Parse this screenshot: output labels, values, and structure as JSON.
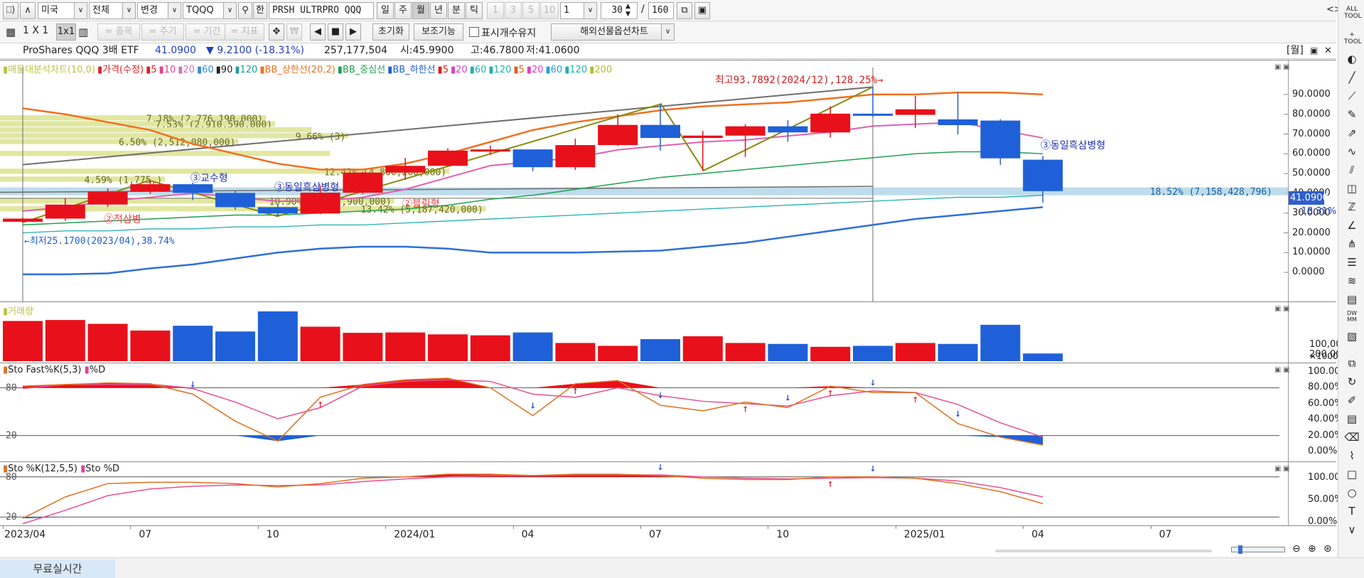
{
  "toolbar1": {
    "market": "미국",
    "scope": "전체",
    "change": "변경",
    "code": "TQQQ",
    "han": "한",
    "name": "PRSH ULTRPRO QQQ",
    "periods": [
      {
        "label": "일"
      },
      {
        "label": "주"
      },
      {
        "label": "월"
      },
      {
        "label": "년"
      },
      {
        "label": "분"
      },
      {
        "label": "틱"
      }
    ],
    "intervals": [
      {
        "label": "1"
      },
      {
        "label": "3"
      },
      {
        "label": "5"
      },
      {
        "label": "10"
      }
    ],
    "interval_value": "1",
    "count_value": "30",
    "total": "160",
    "slash": "/"
  },
  "toolbar2": {
    "layout_single": "1 X 1",
    "layout_1x1": "1x1",
    "item": "= 종목",
    "period": "= 주기",
    "range": "= 기간",
    "indicator": "= 지표",
    "reset": "초기화",
    "aux": "보조기능",
    "show_count": "표시개수유지",
    "futures": "해외선물옵션차트"
  },
  "info": {
    "name": "ProShares QQQ 3배 ETF",
    "price": "41.0900",
    "change": "▼ 9.2100 (-18.31%)",
    "volume": "257,177,504",
    "open": "시:45.9900",
    "high": "고:46.7800",
    "low": "저:41.0600",
    "period_tag": "[월]"
  },
  "price_panel": {
    "legend": [
      {
        "t": "매물대분석차트(10,0)",
        "c": "#b8c44a"
      },
      {
        "t": "가격(수정)",
        "c": "#e02020"
      },
      {
        "t": "5",
        "c": "#e02020"
      },
      {
        "t": "10",
        "c": "#e8408a"
      },
      {
        "t": "20",
        "c": "#d070c0"
      },
      {
        "t": "60",
        "c": "#3a8ad8"
      },
      {
        "t": "90",
        "c": "#222222"
      },
      {
        "t": "120",
        "c": "#20a0a0"
      },
      {
        "t": "BB_상한선(20,2)",
        "c": "#f07020"
      },
      {
        "t": "BB_중심선",
        "c": "#20a050"
      },
      {
        "t": "BB_하한선",
        "c": "#2060d0"
      },
      {
        "t": "5",
        "c": "#e02020"
      },
      {
        "t": "20",
        "c": "#e040c0"
      },
      {
        "t": "60",
        "c": "#20b0b0"
      },
      {
        "t": "120",
        "c": "#20b0b0"
      },
      {
        "t": "5",
        "c": "#e06020"
      },
      {
        "t": "20",
        "c": "#e040c0"
      },
      {
        "t": "60",
        "c": "#20a0e0"
      },
      {
        "t": "120",
        "c": "#20b0b0"
      },
      {
        "t": "200",
        "c": "#b0c030"
      }
    ],
    "y_ticks": [
      "90.0000",
      "80.0000",
      "70.0000",
      "60.0000",
      "50.0000",
      "40.0000",
      "30.0000",
      "20.0000",
      "10.0000",
      "0.0000"
    ],
    "current_price": "41.0900",
    "current_change": "-18.31%",
    "high_label": "최고93.7892(2024/12),128.25%→",
    "low_label": "←최저25.1700(2023/04),38.74%",
    "volume_profile_labels": [
      "7.18% (2,776,190,000)",
      "7.53% (2,910,590,000)",
      "6.50% (2,512,080,000)",
      "9.66% (3",
      "4.59% (1,775,",
      "12.42% (4,800,260,000)",
      "10.90% (4,212,900,000)",
      "13.42% (5,187,420,000)",
      "18.52% (7,158,428,796)"
    ],
    "vp_partial": "00,000)",
    "patterns": [
      {
        "text": "③교수형",
        "c": "#2030b0"
      },
      {
        "text": "③동일흑삼병형",
        "c": "#2030b0"
      },
      {
        "text": "②블릭형",
        "c": "#e04040"
      },
      {
        "text": "②적삼병",
        "c": "#e04040"
      },
      {
        "text": "③동일흑삼병형",
        "c": "#2030b0"
      }
    ]
  },
  "volume_panel": {
    "title": "거래량",
    "y_ticks": [
      "200,000",
      "100,000",
      "×10000"
    ]
  },
  "sto_fast": {
    "title_k": "Sto Fast%K(5,3)",
    "title_d": "%D",
    "y_ticks": [
      "100.00%",
      "80.00%",
      "60.00%",
      "40.00%",
      "20.00%",
      "0.00%"
    ],
    "levels": [
      "80",
      "20"
    ]
  },
  "sto_slow": {
    "title_k": "Sto %K(12,5,5)",
    "title_d": "Sto %D",
    "y_ticks": [
      "100.00%",
      "50.00%",
      "0.00%"
    ],
    "levels": [
      "80",
      "20"
    ]
  },
  "x_axis": [
    "2023/04",
    "07",
    "10",
    "2024/01",
    "04",
    "07",
    "10",
    "2025/01",
    "04",
    "07"
  ],
  "status": {
    "tab": "무료실시간"
  },
  "chart_data": {
    "type": "candlestick",
    "x": [
      "2023/04",
      "2023/05",
      "2023/06",
      "2023/07",
      "2023/08",
      "2023/09",
      "2023/10",
      "2023/11",
      "2023/12",
      "2024/01",
      "2024/02",
      "2024/03",
      "2024/04",
      "2024/05",
      "2024/06",
      "2024/07",
      "2024/08",
      "2024/09",
      "2024/10",
      "2024/11",
      "2024/12",
      "2025/01",
      "2025/02",
      "2025/03",
      "2025/04"
    ],
    "candles": [
      {
        "o": 25.6,
        "h": 27.9,
        "l": 25.2,
        "c": 27.2,
        "up": true
      },
      {
        "o": 27.2,
        "h": 37.6,
        "l": 26.1,
        "c": 34.3,
        "up": true
      },
      {
        "o": 34.3,
        "h": 42.5,
        "l": 33.1,
        "c": 40.8,
        "up": true
      },
      {
        "o": 40.8,
        "h": 46.5,
        "l": 39.7,
        "c": 44.6,
        "up": true
      },
      {
        "o": 44.6,
        "h": 45.4,
        "l": 36.6,
        "c": 40.2,
        "up": false
      },
      {
        "o": 40.2,
        "h": 41.2,
        "l": 31.6,
        "c": 33.0,
        "up": false
      },
      {
        "o": 33.0,
        "h": 34.2,
        "l": 28.4,
        "c": 29.8,
        "up": false
      },
      {
        "o": 29.8,
        "h": 43.8,
        "l": 29.4,
        "c": 40.3,
        "up": true
      },
      {
        "o": 40.3,
        "h": 51.0,
        "l": 39.6,
        "c": 50.5,
        "up": true
      },
      {
        "o": 50.5,
        "h": 58.0,
        "l": 46.9,
        "c": 53.9,
        "up": true
      },
      {
        "o": 53.9,
        "h": 62.8,
        "l": 53.5,
        "c": 61.6,
        "up": true
      },
      {
        "o": 61.6,
        "h": 64.2,
        "l": 59.6,
        "c": 62.2,
        "up": true
      },
      {
        "o": 62.2,
        "h": 61.5,
        "l": 51.2,
        "c": 53.2,
        "up": false
      },
      {
        "o": 53.2,
        "h": 67.7,
        "l": 51.8,
        "c": 64.4,
        "up": true
      },
      {
        "o": 64.4,
        "h": 80.0,
        "l": 64.0,
        "c": 74.6,
        "up": true
      },
      {
        "o": 74.6,
        "h": 85.2,
        "l": 61.6,
        "c": 68.0,
        "up": false
      },
      {
        "o": 68.0,
        "h": 71.6,
        "l": 51.5,
        "c": 69.2,
        "up": true
      },
      {
        "o": 69.2,
        "h": 75.0,
        "l": 58.4,
        "c": 73.9,
        "up": true
      },
      {
        "o": 73.9,
        "h": 77.0,
        "l": 66.2,
        "c": 70.8,
        "up": false
      },
      {
        "o": 70.8,
        "h": 84.0,
        "l": 68.3,
        "c": 80.3,
        "up": true
      },
      {
        "o": 80.3,
        "h": 93.8,
        "l": 78.6,
        "c": 79.7,
        "up": false
      },
      {
        "o": 79.7,
        "h": 89.3,
        "l": 73.0,
        "c": 82.5,
        "up": true
      },
      {
        "o": 77.4,
        "h": 91.2,
        "l": 69.8,
        "c": 74.5,
        "up": false
      },
      {
        "o": 76.8,
        "h": 77.5,
        "l": 54.4,
        "c": 57.7,
        "up": false
      },
      {
        "o": 57.0,
        "h": 58.9,
        "l": 35.3,
        "c": 41.1,
        "up": false
      }
    ],
    "volume_x10000": [
      210000,
      215000,
      195000,
      160000,
      185000,
      155000,
      260000,
      180000,
      148000,
      150000,
      140000,
      135000,
      150000,
      95000,
      80000,
      115000,
      130000,
      95000,
      90000,
      75000,
      80000,
      95000,
      90000,
      190000,
      40000
    ],
    "sto_fast_k": [
      82,
      84,
      86,
      85,
      72,
      38,
      13,
      68,
      84,
      90,
      92,
      80,
      45,
      85,
      89,
      58,
      51,
      62,
      55,
      82,
      74,
      74,
      35,
      18,
      8
    ],
    "sto_fast_d": [
      79,
      84,
      84,
      84,
      79,
      62,
      41,
      55,
      82,
      88,
      90,
      88,
      72,
      68,
      80,
      70,
      63,
      60,
      57,
      70,
      76,
      74,
      59,
      36,
      18
    ],
    "sto_slow_k": [
      18,
      50,
      70,
      72,
      72,
      70,
      65,
      70,
      78,
      80,
      84,
      84,
      82,
      84,
      84,
      82,
      78,
      76,
      76,
      80,
      80,
      78,
      70,
      58,
      40
    ],
    "sto_slow_d": [
      10,
      30,
      52,
      62,
      66,
      68,
      67,
      68,
      73,
      77,
      80,
      82,
      82,
      83,
      83,
      83,
      80,
      78,
      77,
      78,
      79,
      78,
      74,
      64,
      50
    ],
    "ma5": [
      31,
      33,
      36,
      38,
      40,
      38,
      36,
      36,
      38,
      42,
      48,
      54,
      56,
      58,
      62,
      64,
      66,
      67,
      69,
      71,
      74,
      75,
      76,
      72,
      68
    ],
    "ma20": [
      24,
      25,
      26,
      27,
      28,
      29,
      29,
      30,
      31,
      32,
      34,
      37,
      39,
      42,
      45,
      48,
      50,
      52,
      54,
      56,
      58,
      60,
      61,
      61,
      60
    ],
    "ma60": [
      20,
      21,
      21,
      22,
      22,
      23,
      23,
      24,
      24,
      25,
      26,
      27,
      28,
      29,
      30,
      31,
      32,
      33,
      34,
      35,
      36,
      37,
      38,
      38,
      39
    ],
    "bb_upper": [
      83,
      80,
      76,
      72,
      65,
      60,
      55,
      52,
      52,
      55,
      60,
      66,
      72,
      76,
      79,
      82,
      84,
      85,
      86,
      88,
      90,
      90,
      91,
      91,
      90
    ],
    "bb_lower": [
      -1,
      -1,
      -0.5,
      2,
      4,
      7,
      10,
      12,
      13,
      13,
      12,
      10,
      10,
      10,
      10.5,
      11,
      13,
      15,
      18,
      21,
      24,
      27,
      29,
      31,
      33
    ],
    "pnl": {
      "ylim": [
        -5,
        95
      ]
    },
    "volume_profile": [
      {
        "low": 76.5,
        "high": 79.5,
        "pct": "7.18%",
        "val": "2,776,190,000",
        "w": 0.29
      },
      {
        "low": 73.5,
        "high": 76.5,
        "pct": "7.53%",
        "val": "2,910,590,000",
        "w": 0.3
      },
      {
        "low": 70.5,
        "high": 73.5,
        "pct": "",
        "val": "",
        "w": 0.34
      },
      {
        "low": 67.5,
        "high": 70.5,
        "pct": "9.66%",
        "val": "3",
        "w": 0.38
      },
      {
        "low": 64.5,
        "high": 67.5,
        "pct": "6.50%",
        "val": "2,512,080,000",
        "w": 0.26
      },
      {
        "low": 58.5,
        "high": 61.5,
        "pct": "",
        "val": "00,000",
        "w": 0.36
      },
      {
        "low": 49.5,
        "high": 52.5,
        "pct": "12.42%",
        "val": "4,800,260,000",
        "w": 0.49
      },
      {
        "low": 45.5,
        "high": 48.5,
        "pct": "4.59%",
        "val": "1,775,",
        "w": 0.18
      },
      {
        "low": 34.5,
        "high": 37.5,
        "pct": "10.90%",
        "val": "4,212,900,000",
        "w": 0.43
      },
      {
        "low": 30.5,
        "high": 33.5,
        "pct": "13.42%",
        "val": "5,187,420,000",
        "w": 0.53
      }
    ]
  }
}
